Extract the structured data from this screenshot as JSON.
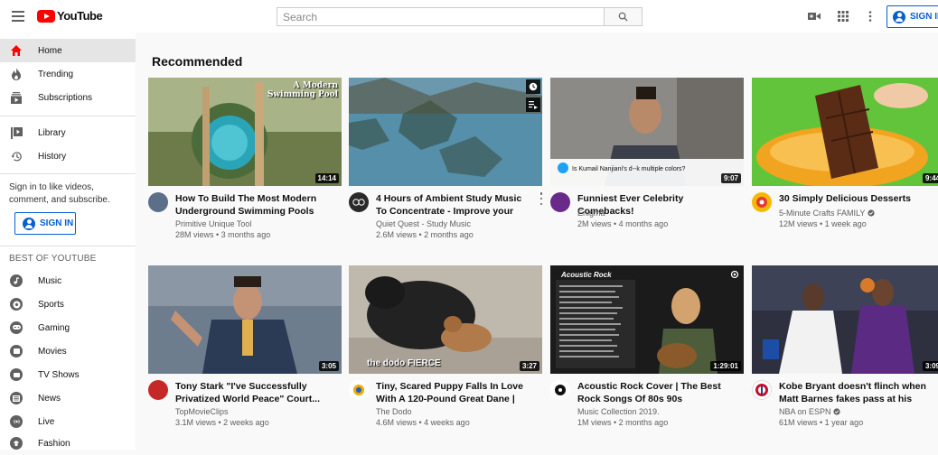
{
  "header": {
    "logo_text": "YouTube",
    "search_placeholder": "Search",
    "signin_label": "SIGN IN",
    "icons": [
      "menu-icon",
      "search-icon",
      "video-camera-icon",
      "apps-grid-icon",
      "more-vert-icon"
    ]
  },
  "sidebar": {
    "primary": [
      {
        "label": "Home",
        "icon": "home-icon",
        "active": true
      },
      {
        "label": "Trending",
        "icon": "flame-icon"
      },
      {
        "label": "Subscriptions",
        "icon": "subscriptions-icon"
      }
    ],
    "secondary": [
      {
        "label": "Library",
        "icon": "library-icon"
      },
      {
        "label": "History",
        "icon": "history-icon"
      }
    ],
    "signin_prompt": "Sign in to like videos, comment, and subscribe.",
    "signin_label": "SIGN IN",
    "section_title": "BEST OF YOUTUBE",
    "best": [
      {
        "label": "Music",
        "icon": "music-icon"
      },
      {
        "label": "Sports",
        "icon": "sports-icon"
      },
      {
        "label": "Gaming",
        "icon": "gaming-icon"
      },
      {
        "label": "Movies",
        "icon": "movies-icon"
      },
      {
        "label": "TV Shows",
        "icon": "tv-icon"
      },
      {
        "label": "News",
        "icon": "news-icon"
      },
      {
        "label": "Live",
        "icon": "live-icon"
      },
      {
        "label": "Fashion",
        "icon": "fashion-icon"
      }
    ]
  },
  "main": {
    "section_title": "Recommended",
    "videos": [
      {
        "title": "How To Build The Most Modern Underground Swimming Pools wit...",
        "channel": "Primitive Unique Tool",
        "meta": "28M views • 3 months ago",
        "duration": "14:14",
        "thumb_text": "A Modern Swimming Pool"
      },
      {
        "title": "4 Hours of Ambient Study Music To Concentrate - Improve your Focus...",
        "channel": "Quiet Quest - Study Music",
        "meta": "2.6M views • 2 months ago",
        "duration": "",
        "thumb_text": ""
      },
      {
        "title": "Funniest Ever Celebrity Comebacks!",
        "channel": "Enigma",
        "meta": "2M views • 4 months ago",
        "duration": "9:07",
        "thumb_text": "Is Kumail Nanjiani's d--k multiple colors?"
      },
      {
        "title": "30 Simply Delicious Desserts",
        "channel": "5-Minute Crafts FAMILY",
        "meta": "12M views • 1 week ago",
        "duration": "9:44",
        "thumb_text": ""
      },
      {
        "title": "Tony Stark \"I've Successfully Privatized World Peace\" Court...",
        "channel": "TopMovieClips",
        "meta": "3.1M views • 2 weeks ago",
        "duration": "3:05",
        "thumb_text": ""
      },
      {
        "title": "Tiny, Scared Puppy Falls In Love With A 120-Pound Great Dane | Th...",
        "channel": "The Dodo",
        "meta": "4.6M views • 4 weeks ago",
        "duration": "3:27",
        "thumb_text": "the dodo FIERCE"
      },
      {
        "title": "Acoustic Rock Cover | The Best Rock Songs Of 80s 90s",
        "channel": "Music Collection 2019.",
        "meta": "1M views • 2 months ago",
        "duration": "1:29:01",
        "thumb_text": "Acoustic Rock"
      },
      {
        "title": "Kobe Bryant doesn't flinch when Matt Barnes fakes pass at his face...",
        "channel": "NBA on ESPN",
        "meta": "61M views • 1 year ago",
        "duration": "3:09",
        "thumb_text": ""
      }
    ]
  }
}
